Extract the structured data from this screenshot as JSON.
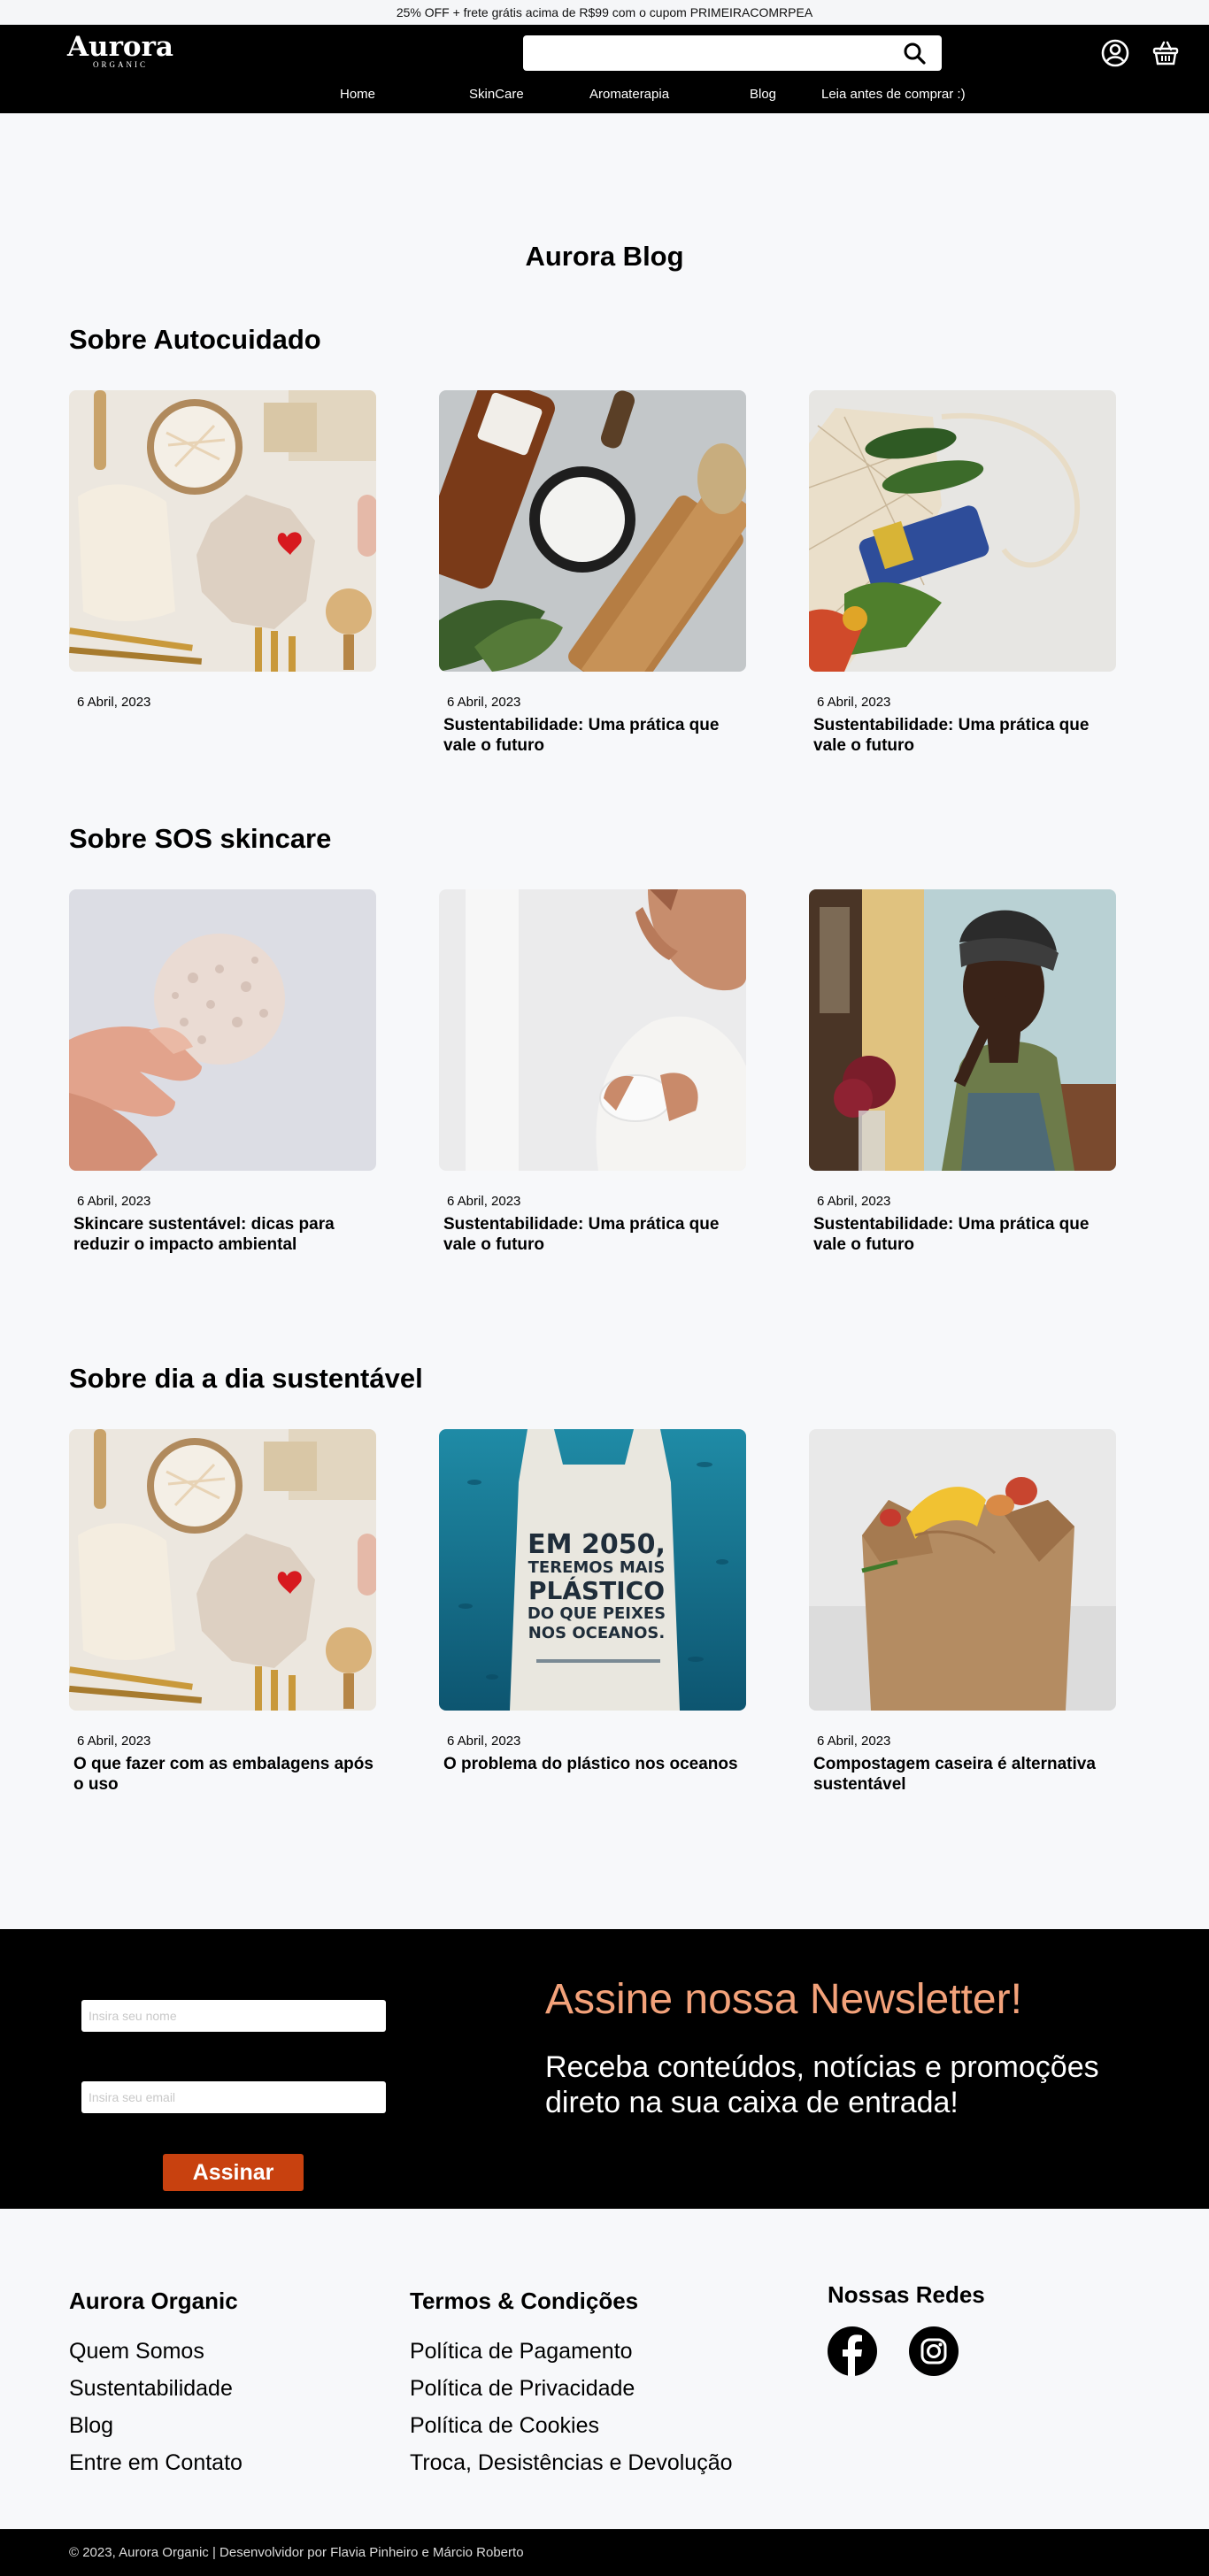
{
  "promo": "25% OFF + frete grátis acima de R$99 com o cupom PRIMEIRACOMRPEA",
  "header": {
    "logo_name": "Aurora",
    "logo_sub": "ORGANIC",
    "search_placeholder": "",
    "icons": [
      "search-icon",
      "user-icon",
      "basket-icon"
    ]
  },
  "nav": [
    "Home",
    "SkinCare",
    "Aromaterapia",
    "Blog",
    "Leia antes de comprar :)"
  ],
  "blog": {
    "title": "Aurora Blog",
    "sections": [
      {
        "title": "Sobre Autocuidado",
        "cards": [
          {
            "date": "6 Abril, 2023",
            "title": ""
          },
          {
            "date": "6 Abril, 2023",
            "title": "Sustentabilidade: Uma prática que vale o futuro"
          },
          {
            "date": "6 Abril, 2023",
            "title": "Sustentabilidade: Uma prática que vale o futuro"
          }
        ]
      },
      {
        "title": "Sobre SOS skincare",
        "cards": [
          {
            "date": "6 Abril, 2023",
            "title": "Skincare sustentável: dicas para reduzir o impacto ambiental"
          },
          {
            "date": "6 Abril, 2023",
            "title": "Sustentabilidade: Uma prática que vale o futuro"
          },
          {
            "date": "6 Abril, 2023",
            "title": "Sustentabilidade: Uma prática que vale o futuro"
          }
        ]
      },
      {
        "title": "Sobre dia a dia sustentável",
        "cards": [
          {
            "date": "6 Abril, 2023",
            "title": "O que fazer com as embalagens após o uso"
          },
          {
            "date": "6 Abril, 2023",
            "title": "O problema do plástico nos oceanos"
          },
          {
            "date": "6 Abril, 2023",
            "title": "Compostagem caseira é alternativa sustentável"
          }
        ]
      }
    ],
    "poster_text": [
      "EM 2050,",
      "TEREMOS MAIS",
      "PLÁSTICO",
      "DO QUE PEIXES",
      "NOS OCEANOS."
    ]
  },
  "newsletter": {
    "name_placeholder": "Insira seu nome",
    "email_placeholder": "Insira seu email",
    "button": "Assinar",
    "title": "Assine nossa Newsletter!",
    "text": "Receba conteúdos, notícias e promoções direto na sua caixa de entrada!"
  },
  "footer": {
    "col1": {
      "title": "Aurora Organic",
      "links": [
        "Quem Somos",
        "Sustentabilidade",
        "Blog",
        "Entre em Contato"
      ]
    },
    "col2": {
      "title": "Termos & Condições",
      "links": [
        "Política de Pagamento",
        "Política de Privacidade",
        "Política de Cookies",
        "Troca, Desistências e Devolução"
      ]
    },
    "social": {
      "title": "Nossas Redes",
      "icons": [
        "facebook-icon",
        "instagram-icon"
      ]
    },
    "copyright": "© 2023, Aurora Organic | Desenvolvidor por Flavia Pinheiro e Márcio Roberto"
  },
  "colors": {
    "header_bg": "#000000",
    "accent": "#c8410f",
    "newsletter_title": "#f3a27a",
    "page_bg": "#f7f8fa"
  }
}
